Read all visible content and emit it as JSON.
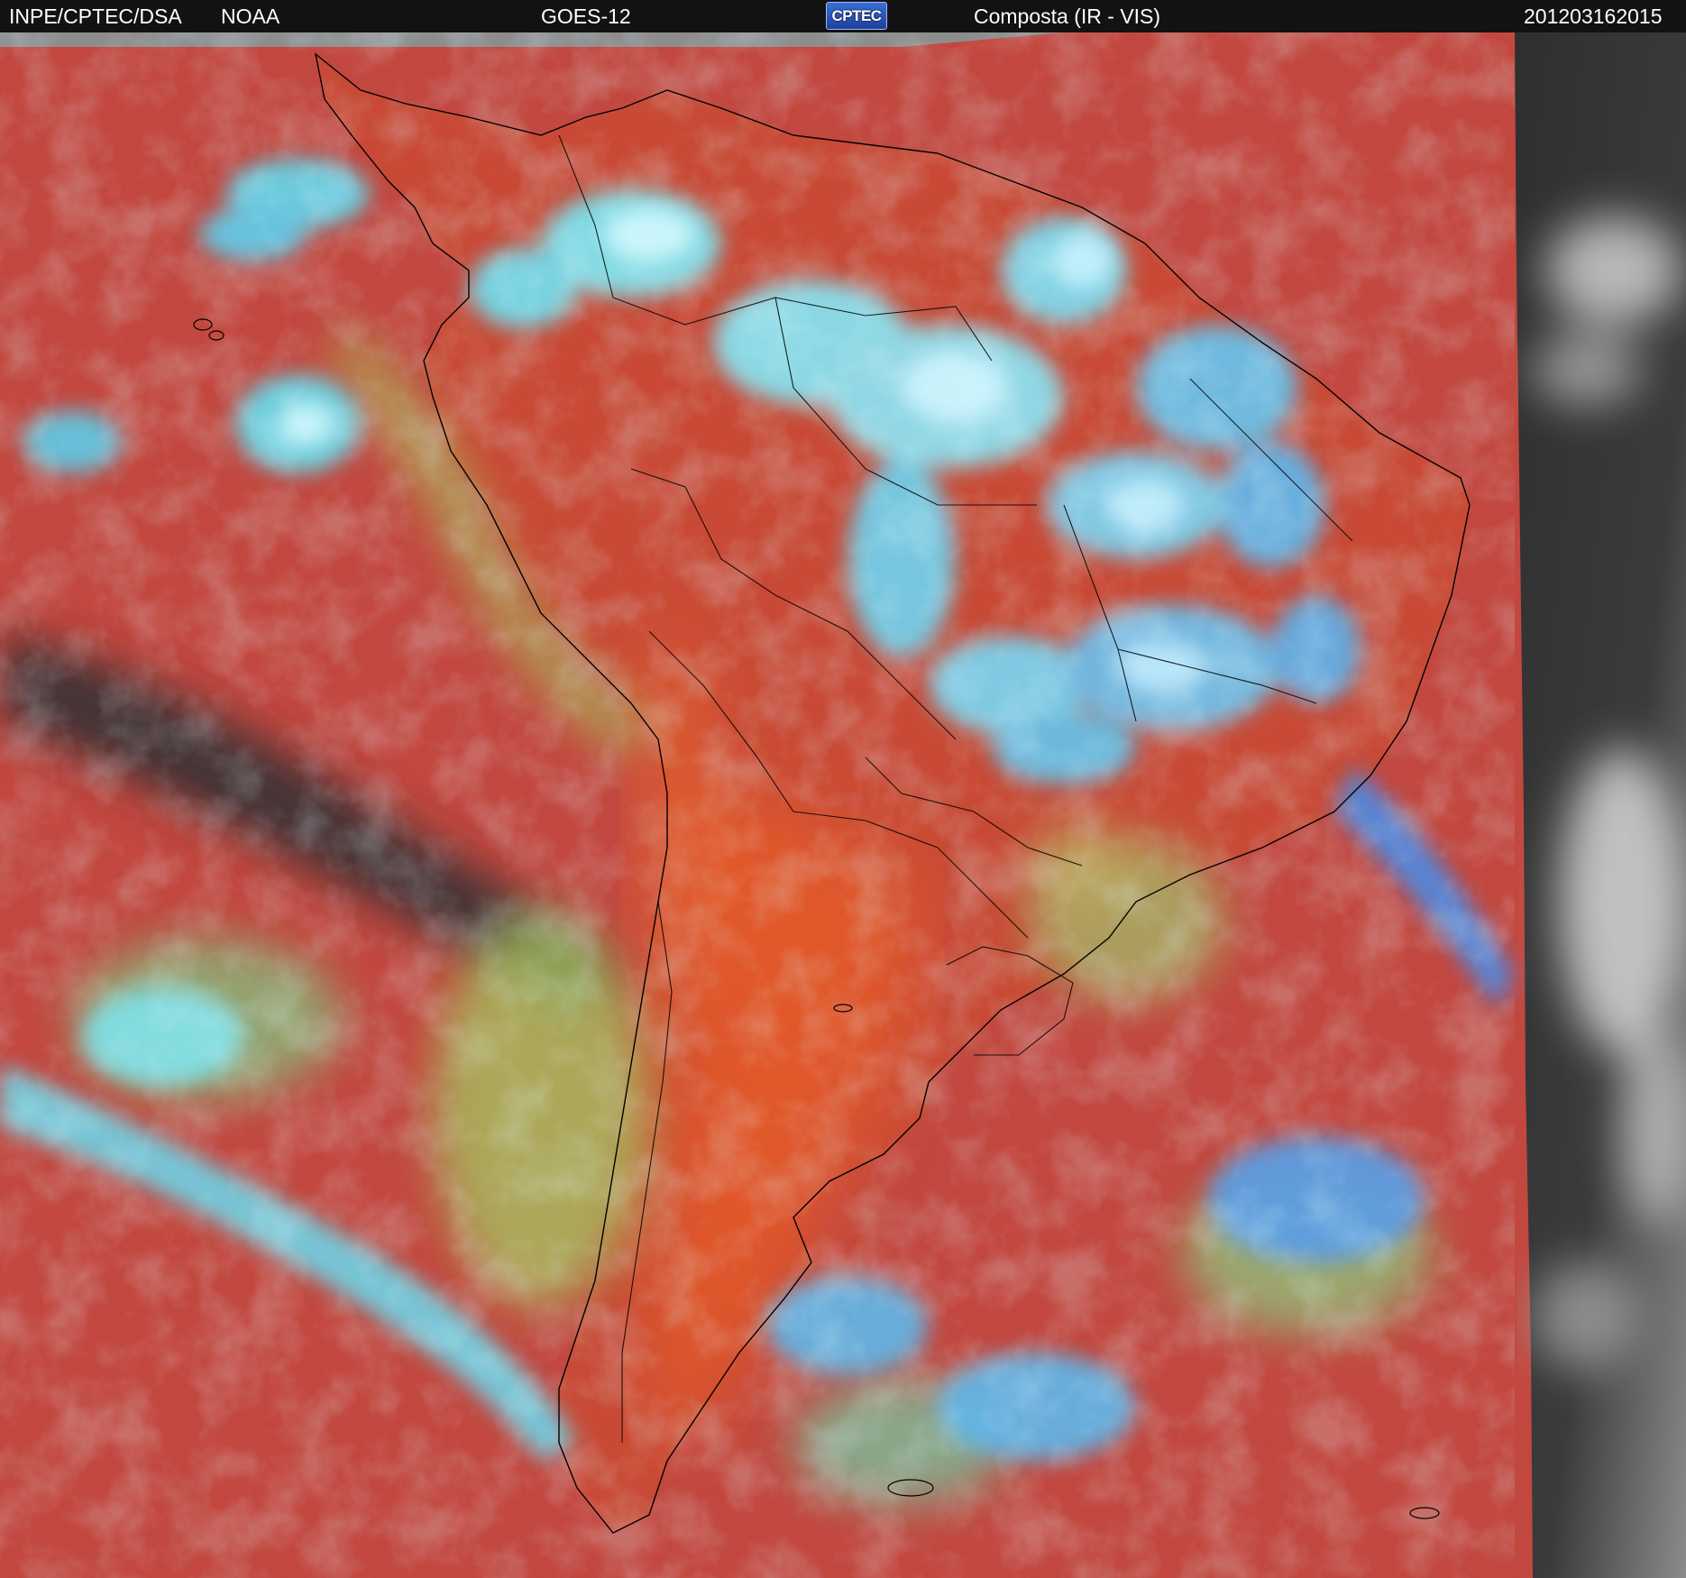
{
  "header": {
    "agency": "INPE/CPTEC/DSA",
    "partner": "NOAA",
    "satellite": "GOES-12",
    "logo_text": "CPTEC",
    "product": "Composta (IR - VIS)",
    "timestamp": "201203162015"
  },
  "image": {
    "scene": "satellite composite of South America",
    "colors": {
      "clear_sky": "#c4483f",
      "warm_land": "#e05a2a",
      "low_cloud": "#a6c862",
      "high_cloud": "#62e4f2",
      "deep_convection": "#cdf6ff",
      "cold_sea_dark": "#2c2b2c",
      "vis_outside_gray": "#3d3d3d",
      "coastline": "#000000"
    }
  }
}
